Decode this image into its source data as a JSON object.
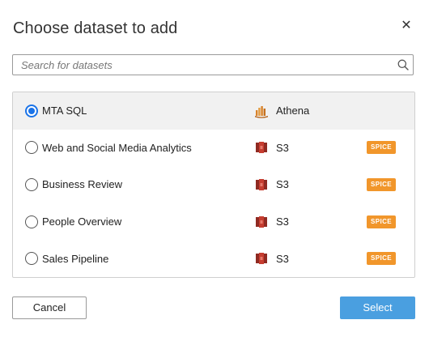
{
  "dialog": {
    "title": "Choose dataset to add",
    "close_icon": "close-icon"
  },
  "search": {
    "placeholder": "Search for datasets",
    "value": "",
    "icon": "search-icon"
  },
  "datasets": [
    {
      "name": "MTA SQL",
      "source": "Athena",
      "source_icon": "athena-icon",
      "badge": "",
      "selected": true
    },
    {
      "name": "Web and Social Media Analytics",
      "source": "S3",
      "source_icon": "s3-icon",
      "badge": "SPICE",
      "selected": false
    },
    {
      "name": "Business Review",
      "source": "S3",
      "source_icon": "s3-icon",
      "badge": "SPICE",
      "selected": false
    },
    {
      "name": "People Overview",
      "source": "S3",
      "source_icon": "s3-icon",
      "badge": "SPICE",
      "selected": false
    },
    {
      "name": "Sales Pipeline",
      "source": "S3",
      "source_icon": "s3-icon",
      "badge": "SPICE",
      "selected": false
    }
  ],
  "footer": {
    "cancel_label": "Cancel",
    "select_label": "Select"
  },
  "colors": {
    "accent": "#4a9fe0",
    "radio_selected": "#1a73e8",
    "spice_badge": "#f1962b",
    "athena_icon": "#d9832a",
    "s3_icon": "#b5332a",
    "selected_row": "#f1f1f1"
  }
}
